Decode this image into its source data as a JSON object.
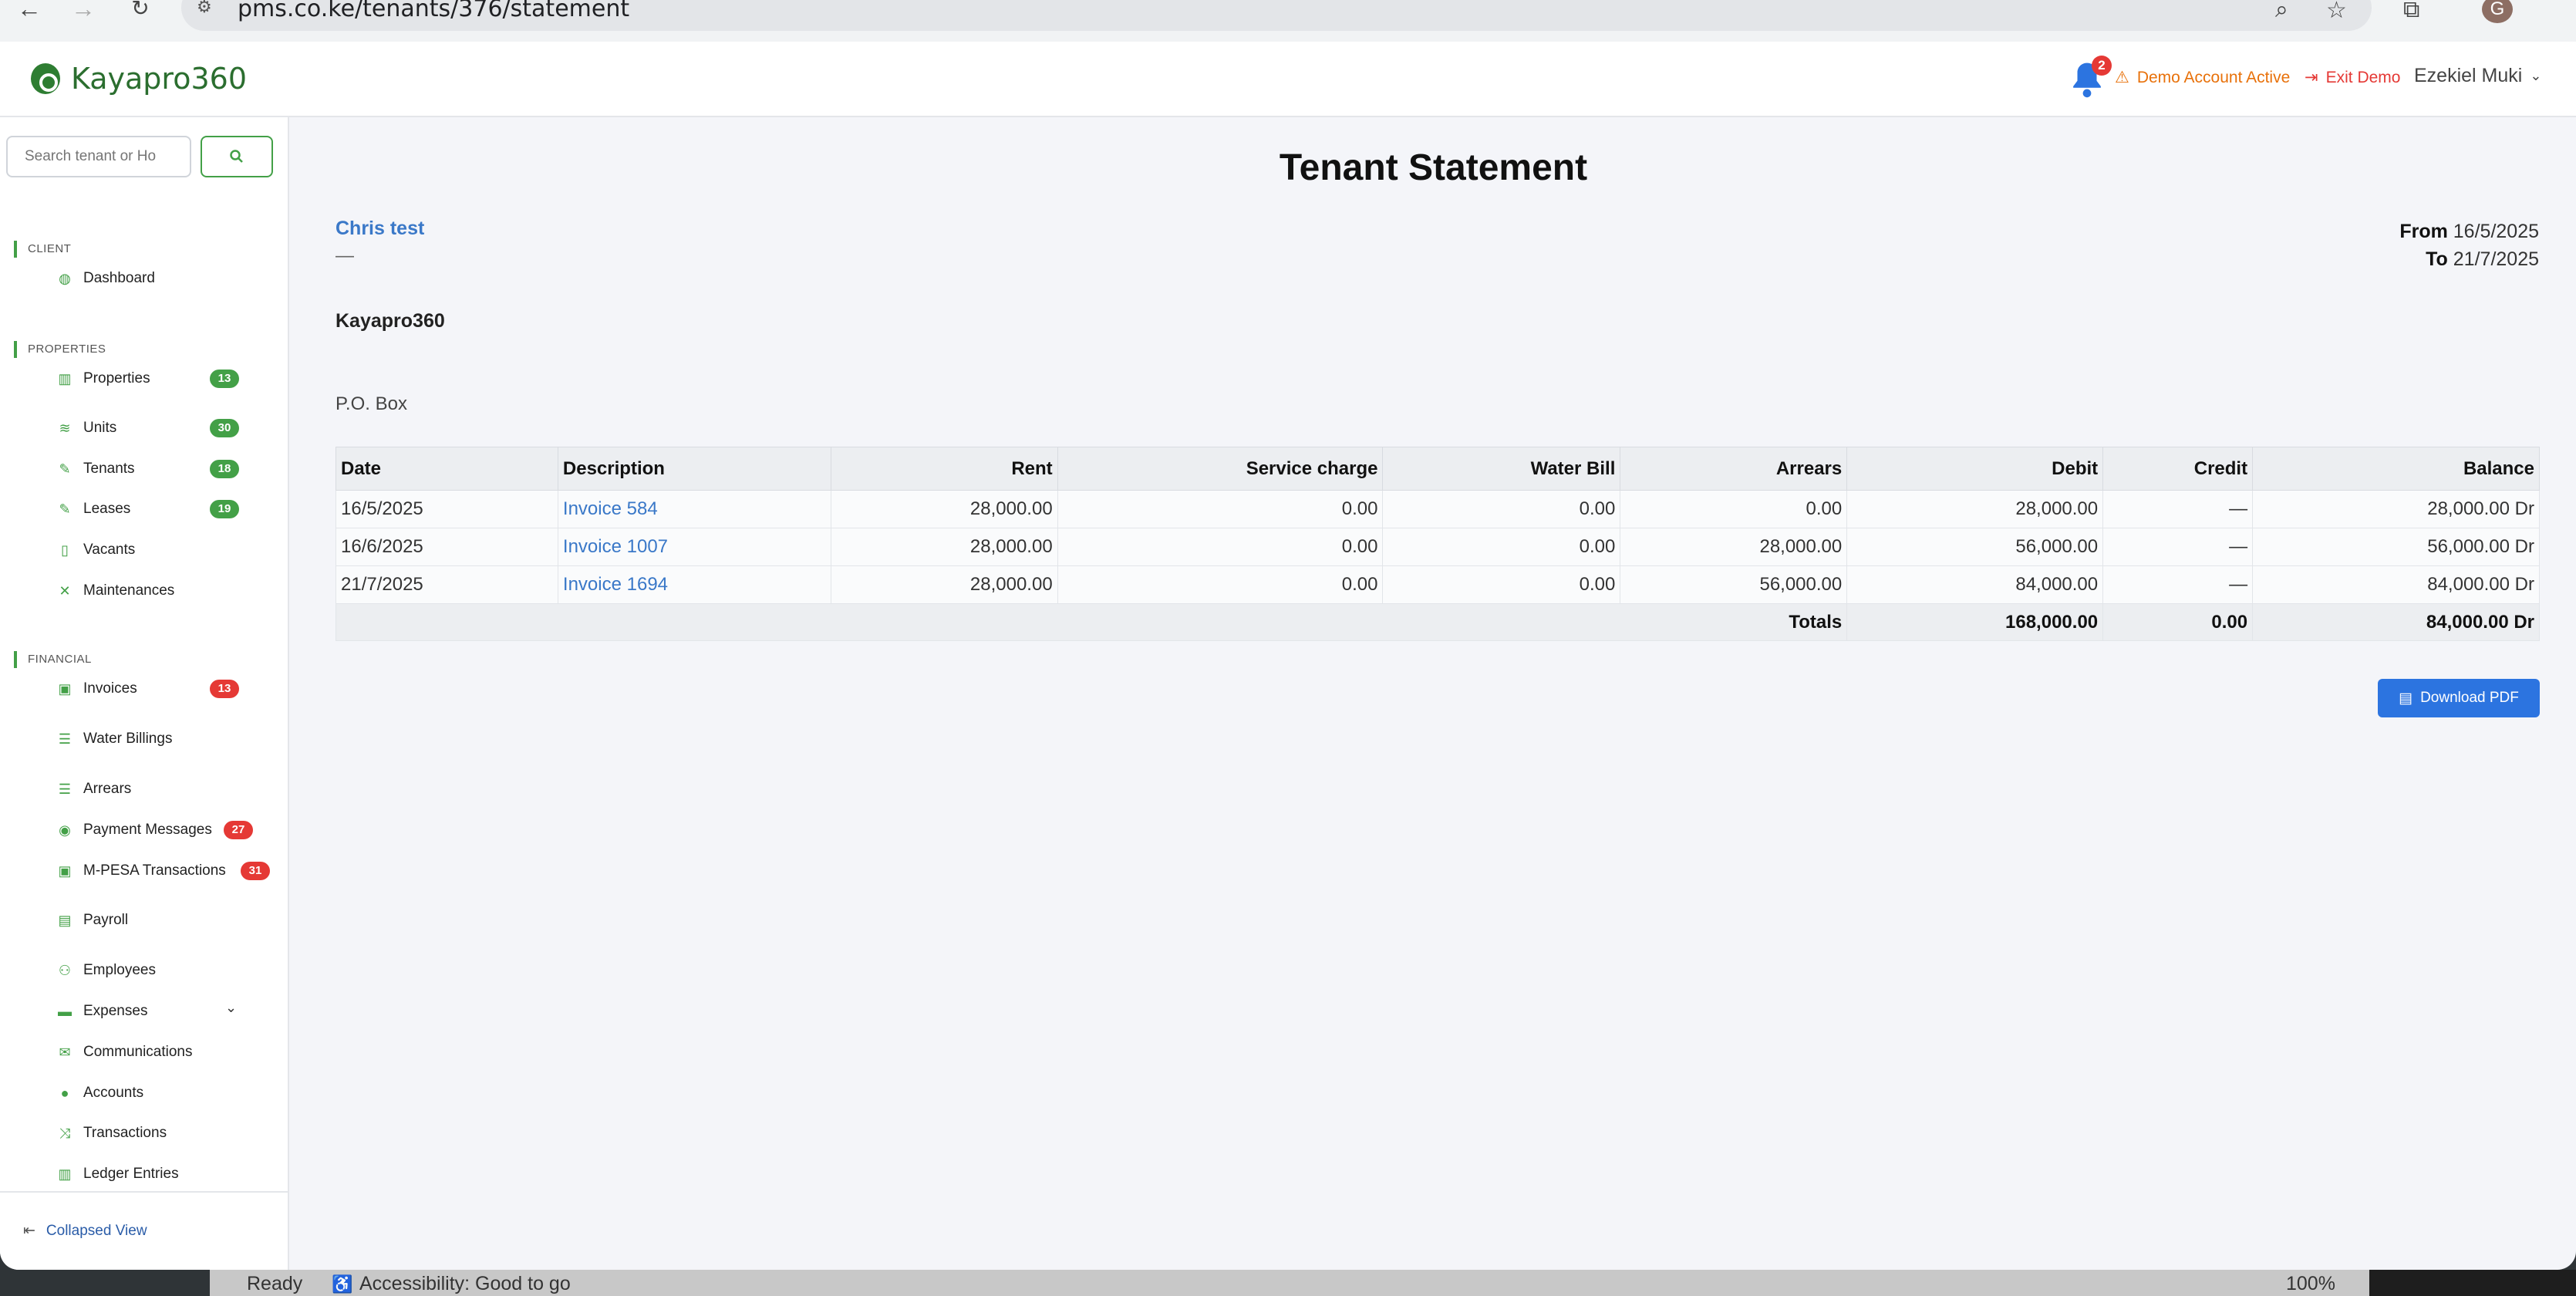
{
  "browser": {
    "url": "pms.co.ke/tenants/376/statement",
    "profile_initial": "G"
  },
  "header": {
    "brand": "Kayapro360",
    "notification_count": "2",
    "demo_status": "Demo Account Active",
    "exit_demo": "Exit Demo",
    "user_name": "Ezekiel Muki"
  },
  "sidebar": {
    "search_placeholder": "Search tenant or Ho",
    "sections": {
      "client": "CLIENT",
      "properties": "PROPERTIES",
      "financial": "FINANCIAL"
    },
    "items": {
      "dashboard": "Dashboard",
      "properties": "Properties",
      "units": "Units",
      "tenants": "Tenants",
      "leases": "Leases",
      "vacants": "Vacants",
      "maintenances": "Maintenances",
      "invoices": "Invoices",
      "water_billings": "Water Billings",
      "arrears": "Arrears",
      "payment_messages": "Payment Messages",
      "mpesa": "M-PESA Transactions",
      "payroll": "Payroll",
      "employees": "Employees",
      "expenses": "Expenses",
      "communications": "Communications",
      "accounts": "Accounts",
      "transactions": "Transactions",
      "ledger_entries": "Ledger Entries"
    },
    "badges": {
      "properties": "13",
      "units": "30",
      "tenants": "18",
      "leases": "19",
      "invoices": "13",
      "payment_messages": "27",
      "mpesa": "31"
    },
    "collapse": "Collapsed View"
  },
  "statement": {
    "title": "Tenant Statement",
    "tenant_name": "Chris test",
    "tenant_sub": "—",
    "from_label": "From",
    "from_date": "16/5/2025",
    "to_label": "To",
    "to_date": "21/7/2025",
    "company": "Kayapro360",
    "po_box": "P.O. Box",
    "columns": [
      "Date",
      "Description",
      "Rent",
      "Service charge",
      "Water Bill",
      "Arrears",
      "Debit",
      "Credit",
      "Balance"
    ],
    "rows": [
      [
        "16/5/2025",
        "Invoice 584",
        "28,000.00",
        "0.00",
        "0.00",
        "0.00",
        "28,000.00",
        "—",
        "28,000.00 Dr"
      ],
      [
        "16/6/2025",
        "Invoice 1007",
        "28,000.00",
        "0.00",
        "0.00",
        "28,000.00",
        "56,000.00",
        "—",
        "56,000.00 Dr"
      ],
      [
        "21/7/2025",
        "Invoice 1694",
        "28,000.00",
        "0.00",
        "0.00",
        "56,000.00",
        "84,000.00",
        "—",
        "84,000.00 Dr"
      ]
    ],
    "totals": {
      "label": "Totals",
      "debit": "168,000.00",
      "credit": "0.00",
      "balance": "84,000.00 Dr"
    },
    "download_pdf": "Download PDF"
  },
  "statusbar": {
    "ready": "Ready",
    "accessibility": "Accessibility: Good to go",
    "zoom": "100%"
  }
}
